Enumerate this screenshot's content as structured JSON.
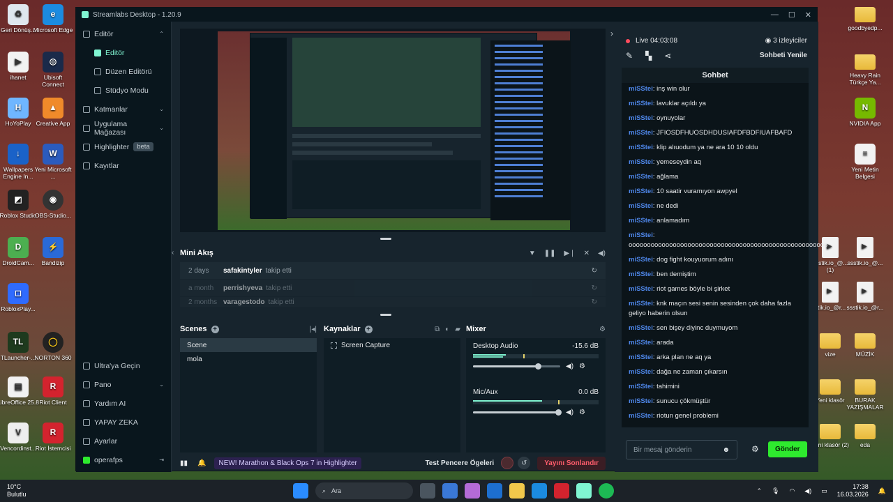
{
  "desktop": {
    "left_icons": [
      "Geri Dönüş...",
      "Microsoft Edge",
      "ihanet",
      "Ubisoft Connect",
      "HoYoPlay",
      "Creative App",
      "Wallpapers Engine In...",
      "Yeni Microsoft ...",
      "Roblox Studio",
      "OBS-Studio...",
      "DroidCam...",
      "Bandizip",
      "RobloxPlay...",
      "TLauncher-...",
      "NORTON 360",
      "LibreOffice 25.8",
      "Riot Client",
      "Vencordinst...",
      "Riot İstemcisi"
    ],
    "right_icons": [
      "goodbyedp...",
      "Heavy Rain Türkçe Ya...",
      "NVIDIA App",
      "Yeni Metin Belgesi",
      "ssstik.io_@... (1)",
      "ssstik.io_@...",
      "stik.io_@r...",
      "ssstik.io_@r...",
      "vize",
      "MÜZİK",
      "Yeni klasör",
      "BURAK YAZIŞMALAR",
      "Yeni klasör (2)",
      "eda"
    ]
  },
  "window": {
    "title": "Streamlabs Desktop - 1.20.9",
    "controls": [
      "—",
      "☐",
      "✕"
    ]
  },
  "sidebar": {
    "items": [
      {
        "label": "Editör",
        "chev": "⌃"
      },
      {
        "label": "Editör"
      },
      {
        "label": "Düzen Editörü"
      },
      {
        "label": "Stüdyo Modu"
      },
      {
        "label": "Katmanlar",
        "chev": "⌄"
      },
      {
        "label": "Uygulama Mağazası",
        "chev": "⌄"
      },
      {
        "label": "Highlighter",
        "badge": "beta"
      },
      {
        "label": "Kayıtlar"
      }
    ],
    "bottom": [
      {
        "label": "Ultra'ya Geçin"
      },
      {
        "label": "Pano",
        "chev": "⌄"
      },
      {
        "label": "Yardım AI"
      },
      {
        "label": "YAPAY ZEKA"
      },
      {
        "label": "Ayarlar"
      },
      {
        "label": "operafps",
        "trail": "⇥"
      }
    ]
  },
  "miniflow": {
    "title": "Mini Akış",
    "rows": [
      {
        "time": "2 days",
        "user": "safakintyler",
        "action": "takip etti"
      },
      {
        "time": "a month",
        "user": "perrishyeva",
        "action": "takip etti"
      },
      {
        "time": "2 months",
        "user": "varagestodo",
        "action": "takip etti"
      }
    ]
  },
  "scenes": {
    "title": "Scenes",
    "items": [
      "Scene",
      "mola"
    ]
  },
  "sources": {
    "title": "Kaynaklar",
    "items": [
      "Screen Capture"
    ]
  },
  "mixer": {
    "title": "Mixer",
    "channels": [
      {
        "name": "Desktop Audio",
        "db": "-15.6 dB",
        "level": 0.75
      },
      {
        "name": "Mic/Aux",
        "db": "0.0 dB",
        "level": 1.0
      }
    ]
  },
  "footer": {
    "promo": "NEW! Marathon & Black Ops 7 in Highlighter",
    "test": "Test Pencere Ögeleri",
    "end": "Yayını Sonlandır"
  },
  "right": {
    "live": "Live 04:03:08",
    "viewers": "3 izleyiciler",
    "refresh": "Sohbeti Yenile",
    "chat_title": "Sohbet",
    "messages": [
      {
        "n": "miSStei",
        "t": ": inş win olur"
      },
      {
        "n": "miSStei",
        "t": ": lavuklar açıldı ya"
      },
      {
        "n": "miSStei",
        "t": ": oynuyolar"
      },
      {
        "n": "miSStei",
        "t": ": JFIOSDFHUOSDHDUSIAFDFBDFIUAFBAFD"
      },
      {
        "n": "miSStei",
        "t": ": klip alıuodum ya ne ara 10 10 oldu"
      },
      {
        "n": "miSStei",
        "t": ": yemeseydin aq"
      },
      {
        "n": "miSStei",
        "t": ": ağlama"
      },
      {
        "n": "miSStei",
        "t": ": 10 saatir vuramıyon awpyel"
      },
      {
        "n": "miSStei",
        "t": ": ne dedi"
      },
      {
        "n": "miSStei",
        "t": ": anlamadım"
      },
      {
        "n": "miSStei",
        "t": ": oooooooooooooooooooooooooooooooooooooooooooooooooooooo"
      },
      {
        "n": "miSStei",
        "t": ": dog fight kouyuorum adını"
      },
      {
        "n": "miSStei",
        "t": ": ben demiştim"
      },
      {
        "n": "miSStei",
        "t": ": riot games böyle bi şirket"
      },
      {
        "n": "miSStei",
        "t": ": knk maçın sesi senin sesinden çok daha fazla geliyo haberin olsun"
      },
      {
        "n": "miSStei",
        "t": ": sen bişey diyinc duymuyom"
      },
      {
        "n": "miSStei",
        "t": ": arada"
      },
      {
        "n": "miSStei",
        "t": ": arka plan ne aq ya"
      },
      {
        "n": "miSStei",
        "t": ": dağa ne zaman çıkarsın"
      },
      {
        "n": "miSStei",
        "t": ": tahimini"
      },
      {
        "n": "miSStei",
        "t": ": sunucu çökmüştür"
      },
      {
        "n": "miSStei",
        "t": ": riotun genel problemi"
      }
    ],
    "input_placeholder": "Bir mesaj gönderin",
    "send": "Gönder"
  },
  "taskbar": {
    "temp": "10°C",
    "weather": "Bulutlu",
    "search": "Ara",
    "time": "17:38",
    "date": "16.03.2026"
  }
}
